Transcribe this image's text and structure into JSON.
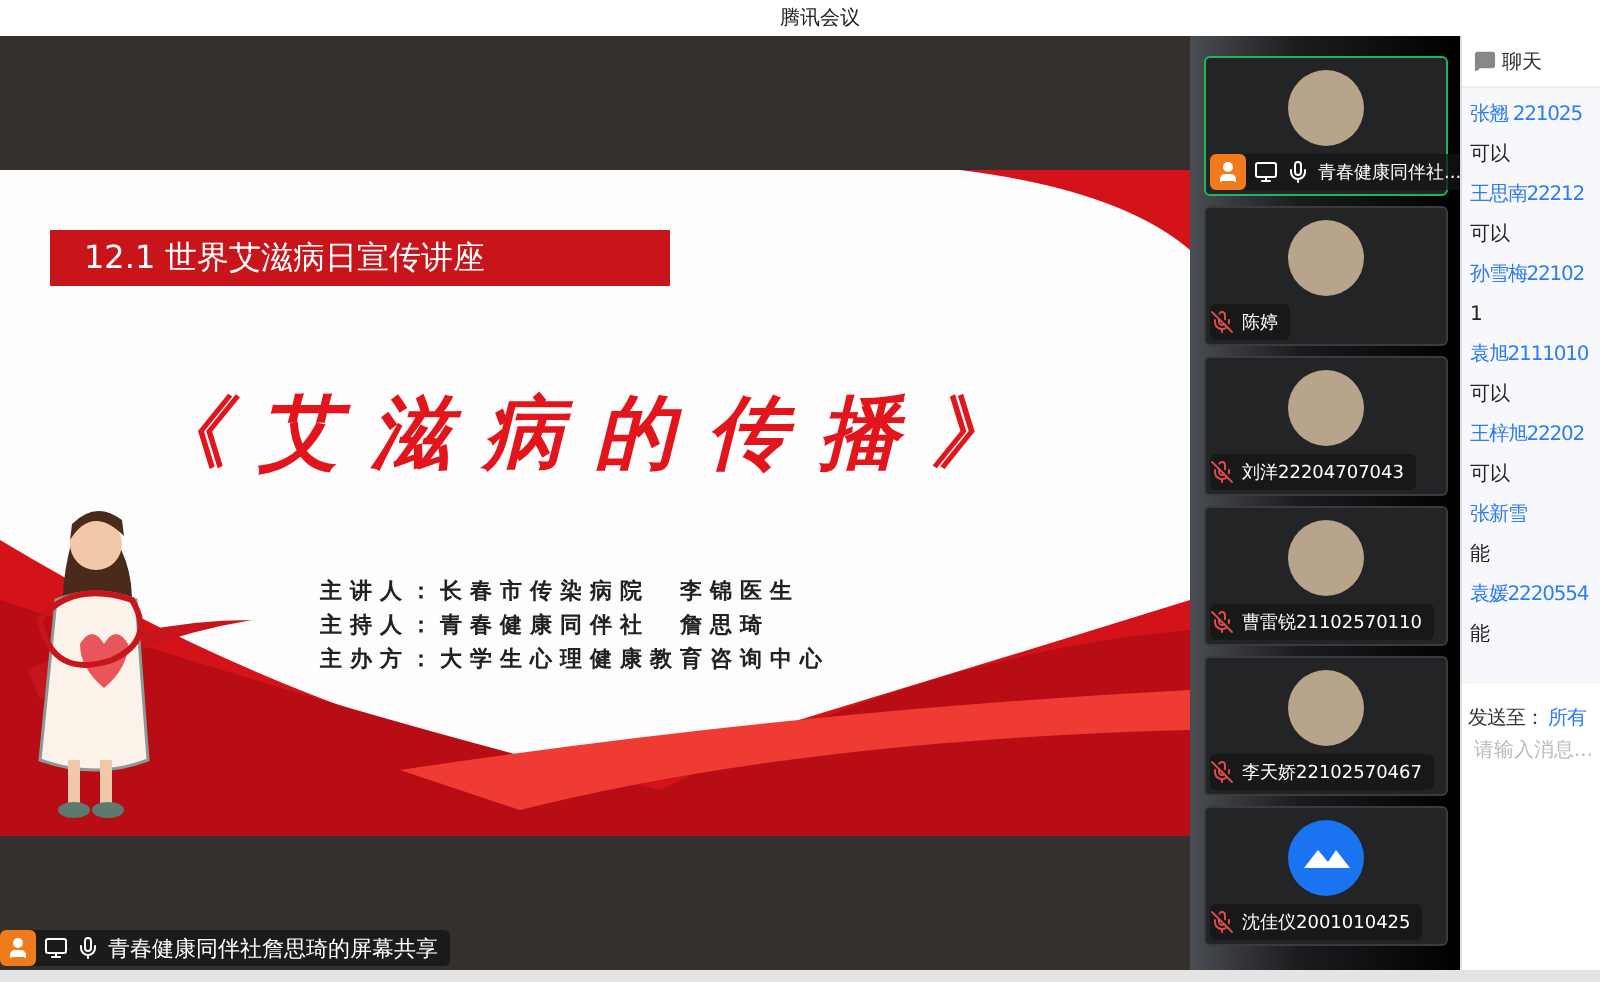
{
  "window": {
    "title": "腾讯会议"
  },
  "slide": {
    "banner": "12.1 世界艾滋病日宣传讲座",
    "title": "《艾滋病的传播》",
    "credits": [
      {
        "label": "主讲人：",
        "value": "长春市传染病院　李锦医生"
      },
      {
        "label": "主持人：",
        "value": "青春健康同伴社　詹思琦"
      },
      {
        "label": "主办方：",
        "value": "大学生心理健康教育咨询中心"
      }
    ]
  },
  "presenter": {
    "name": "青春健康同伴社詹思琦的屏幕共享",
    "host": true,
    "sharing": true,
    "muted": false
  },
  "participants": [
    {
      "name": "青春健康同伴社...",
      "selected": true,
      "host": true,
      "sharing": true,
      "muted": false,
      "kind": "photo"
    },
    {
      "name": "陈婷",
      "selected": false,
      "host": false,
      "sharing": false,
      "muted": true,
      "kind": "photo"
    },
    {
      "name": "刘洋22204707043",
      "selected": false,
      "host": false,
      "sharing": false,
      "muted": true,
      "kind": "photo"
    },
    {
      "name": "曹雷锐21102570110",
      "selected": false,
      "host": false,
      "sharing": false,
      "muted": true,
      "kind": "photo"
    },
    {
      "name": "李天娇22102570467",
      "selected": false,
      "host": false,
      "sharing": false,
      "muted": true,
      "kind": "photo"
    },
    {
      "name": "沈佳仪2001010425",
      "selected": false,
      "host": false,
      "sharing": false,
      "muted": true,
      "kind": "logo"
    }
  ],
  "chat": {
    "title": "聊天",
    "messages": [
      {
        "sender": "张翘 221025",
        "text": "可以"
      },
      {
        "sender": "王思南22212",
        "text": "可以"
      },
      {
        "sender": "孙雪梅22102",
        "text": "1"
      },
      {
        "sender": "袁旭2111010",
        "text": "可以"
      },
      {
        "sender": "王梓旭22202",
        "text": "可以"
      },
      {
        "sender": "张新雪",
        "text": "能"
      },
      {
        "sender": "袁媛2220554",
        "text": "能"
      }
    ],
    "send_to_label": "发送至：",
    "send_to_value": "所有",
    "placeholder": "请输入消息..."
  }
}
